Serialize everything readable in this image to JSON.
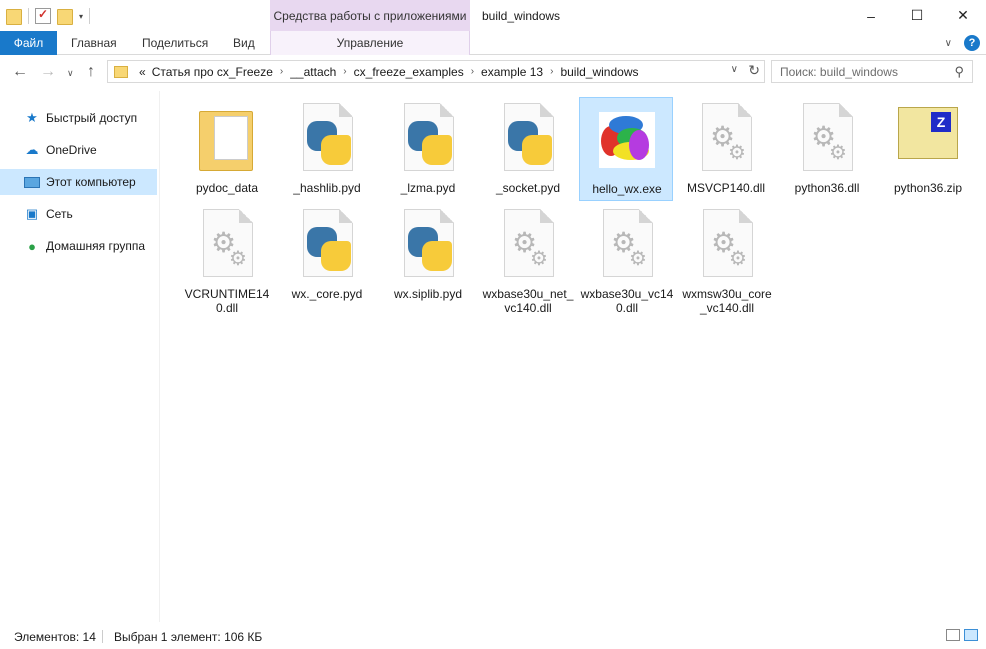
{
  "window": {
    "title": "build_windows",
    "context_tab_group": "Средства работы с приложениями",
    "controls": [
      "–",
      "☐",
      "✕"
    ]
  },
  "ribbon": {
    "tabs": [
      "Файл",
      "Главная",
      "Поделиться",
      "Вид",
      "Управление"
    ]
  },
  "address": {
    "prefix": "«",
    "crumbs": [
      "Статья про cx_Freeze",
      "__attach",
      "cx_freeze_examples",
      "example 13",
      "build_windows"
    ]
  },
  "search": {
    "placeholder": "Поиск: build_windows"
  },
  "nav": {
    "items": [
      {
        "label": "Быстрый доступ",
        "icon": "star-icon"
      },
      {
        "label": "OneDrive",
        "icon": "cloud-icon"
      },
      {
        "label": "Этот компьютер",
        "icon": "computer-icon"
      },
      {
        "label": "Сеть",
        "icon": "network-icon"
      },
      {
        "label": "Домашняя группа",
        "icon": "homegroup-icon"
      }
    ]
  },
  "files": [
    {
      "name": "pydoc_data",
      "type": "folder"
    },
    {
      "name": "_hashlib.pyd",
      "type": "pyd"
    },
    {
      "name": "_lzma.pyd",
      "type": "pyd"
    },
    {
      "name": "_socket.pyd",
      "type": "pyd"
    },
    {
      "name": "hello_wx.exe",
      "type": "exe",
      "selected": true
    },
    {
      "name": "MSVCP140.dll",
      "type": "dll"
    },
    {
      "name": "python36.dll",
      "type": "dll"
    },
    {
      "name": "python36.zip",
      "type": "zip"
    },
    {
      "name": "VCRUNTIME140.dll",
      "type": "dll"
    },
    {
      "name": "wx._core.pyd",
      "type": "pyd"
    },
    {
      "name": "wx.siplib.pyd",
      "type": "pyd"
    },
    {
      "name": "wxbase30u_net_vc140.dll",
      "type": "dll"
    },
    {
      "name": "wxbase30u_vc140.dll",
      "type": "dll"
    },
    {
      "name": "wxmsw30u_core_vc140.dll",
      "type": "dll"
    }
  ],
  "status": {
    "count": "Элементов: 14",
    "selection": "Выбран 1 элемент: 106 КБ"
  }
}
